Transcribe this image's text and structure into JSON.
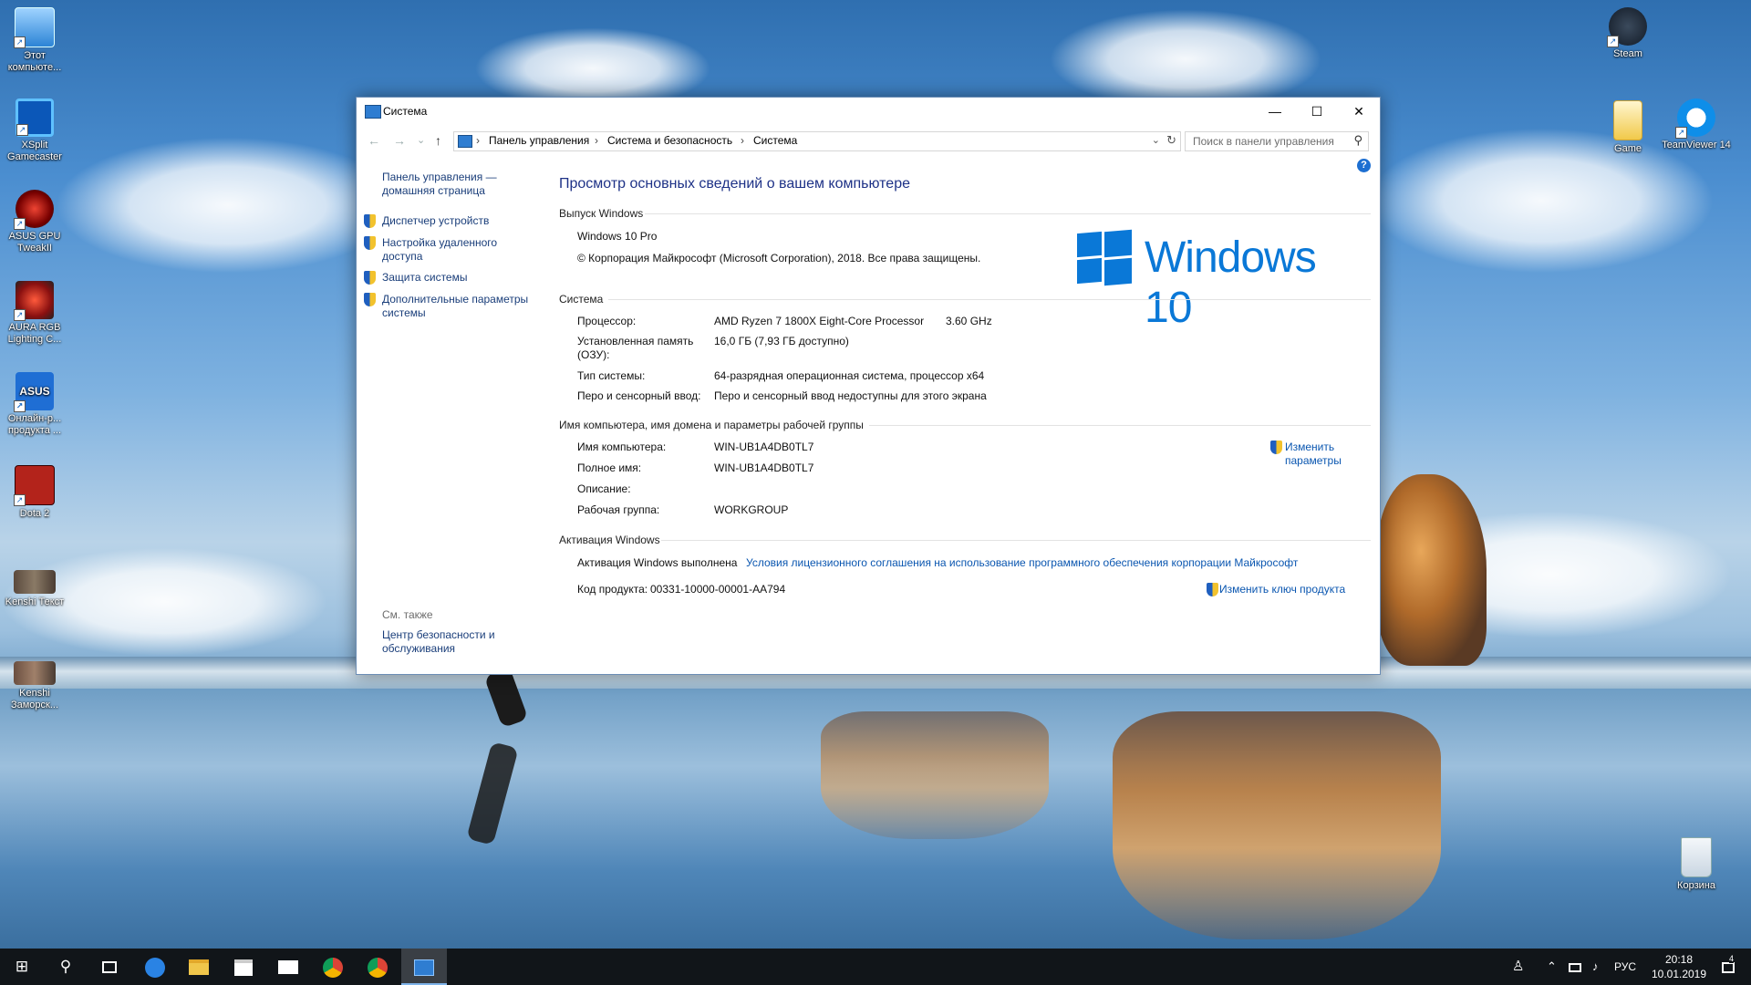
{
  "desktop": {
    "left_icons": [
      {
        "label": "Этот компьюте...",
        "icon": "computer-icon"
      },
      {
        "label": "XSplit Gamecaster",
        "icon": "xsplit-icon"
      },
      {
        "label": "ASUS GPU TweakII",
        "icon": "gpu-tweak-icon"
      },
      {
        "label": "AURA RGB Lighting C...",
        "icon": "aura-icon"
      },
      {
        "label": "Онлайн-р... продукта ...",
        "icon": "asus-icon"
      },
      {
        "label": "Dota 2",
        "icon": "dota-icon"
      },
      {
        "label": "Kenshi Текст",
        "icon": "kenshi-icon"
      },
      {
        "label": "Kenshi Заморск...",
        "icon": "kenshi-icon"
      }
    ],
    "right_icons": [
      {
        "label": "Steam",
        "icon": "steam-icon"
      },
      {
        "label": "Game",
        "icon": "folder-icon"
      },
      {
        "label": "TeamViewer 14",
        "icon": "teamviewer-icon"
      },
      {
        "label": "Корзина",
        "icon": "recycle-bin-icon"
      }
    ]
  },
  "window": {
    "title": "Система",
    "controls": {
      "minimize": "—",
      "maximize": "☐",
      "close": "✕"
    },
    "nav": {
      "back": "←",
      "forward": "→",
      "recent": "⌄",
      "up": "↑"
    },
    "breadcrumbs": [
      "Панель управления",
      "Система и безопасность",
      "Система"
    ],
    "breadcrumb_sep": "›",
    "search_placeholder": "Поиск в панели управления",
    "help": "?",
    "sidebar": {
      "home_link": "Панель управления — домашняя страница",
      "links": [
        "Диспетчер устройств",
        "Настройка удаленного доступа",
        "Защита системы",
        "Дополнительные параметры системы"
      ],
      "see_also_title": "См. также",
      "see_also_link": "Центр безопасности и обслуживания"
    },
    "page_title": "Просмотр основных сведений о вашем компьютере",
    "edition": {
      "heading": "Выпуск Windows",
      "name": "Windows 10 Pro",
      "copyright": "© Корпорация Майкрософт (Microsoft Corporation), 2018. Все права защищены.",
      "logo_text": "Windows 10"
    },
    "system": {
      "heading": "Система",
      "processor_label": "Процессор:",
      "processor_value": "AMD Ryzen 7 1800X Eight-Core Processor",
      "processor_speed": "3.60 GHz",
      "ram_label": "Установленная память (ОЗУ):",
      "ram_value": "16,0 ГБ (7,93 ГБ доступно)",
      "type_label": "Тип системы:",
      "type_value": "64-разрядная операционная система, процессор x64",
      "pen_label": "Перо и сенсорный ввод:",
      "pen_value": "Перо и сенсорный ввод недоступны для этого экрана"
    },
    "computer": {
      "heading": "Имя компьютера, имя домена и параметры рабочей группы",
      "name_label": "Имя компьютера:",
      "name_value": "WIN-UB1A4DB0TL7",
      "full_label": "Полное имя:",
      "full_value": "WIN-UB1A4DB0TL7",
      "desc_label": "Описание:",
      "desc_value": "",
      "workgroup_label": "Рабочая группа:",
      "workgroup_value": "WORKGROUP",
      "change_link": "Изменить параметры"
    },
    "activation": {
      "heading": "Активация Windows",
      "status": "Активация Windows выполнена",
      "license_link": "Условия лицензионного соглашения на использование программного обеспечения корпорации Майкрософт",
      "key_label": "Код продукта:",
      "key_value": "00331-10000-00001-AA794",
      "change_key_link": "Изменить ключ продукта"
    }
  },
  "taskbar": {
    "start": "⊞",
    "search": "⚲",
    "apps": [
      "task-view-icon",
      "edge-icon",
      "explorer-icon",
      "store-icon",
      "mail-icon",
      "chrome-icon",
      "chrome-icon",
      "control-panel-icon"
    ],
    "tray": {
      "people": "♙",
      "chevron": "⌃",
      "language": "РУС",
      "notifications": "4"
    },
    "clock_time": "20:18",
    "clock_date": "10.01.2019"
  }
}
